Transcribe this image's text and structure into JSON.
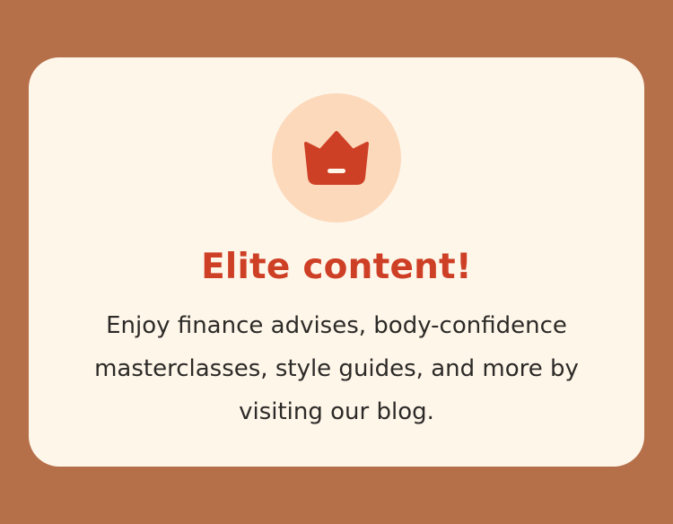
{
  "colors": {
    "background": "#B5704A",
    "card": "#FFF6EA",
    "icon_circle": "#FCD9BB",
    "accent": "#CE4026",
    "body_text": "#2C2A27"
  },
  "card": {
    "icon": "crown-icon",
    "title": "Elite content!",
    "body": "Enjoy finance advises, body-confidence masterclasses, style guides, and more by visiting our blog."
  }
}
